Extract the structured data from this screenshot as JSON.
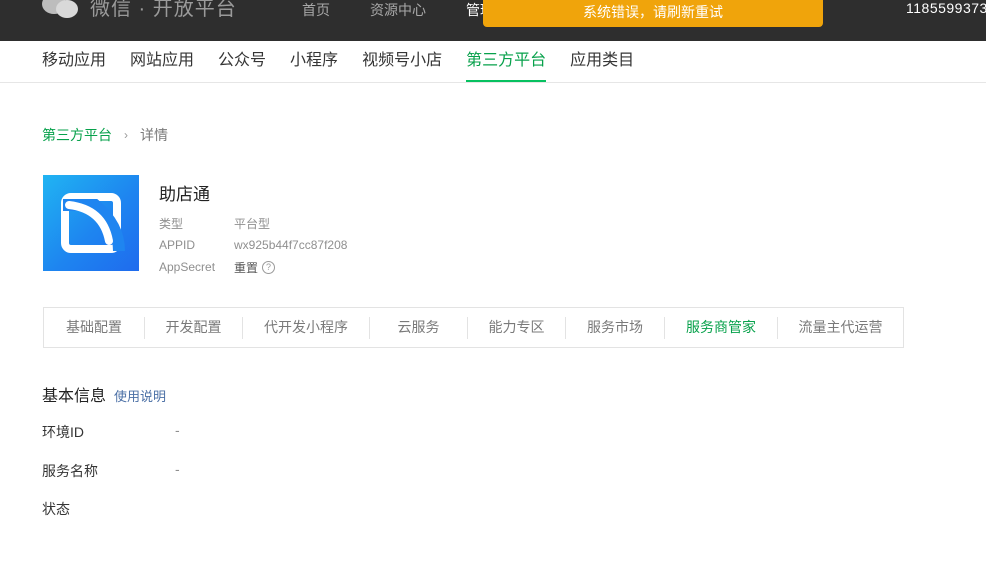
{
  "header": {
    "logo_text": "微信 · 开放平台",
    "nav": [
      "首页",
      "资源中心",
      "管理"
    ],
    "toast": "系统错误，请刷新重试",
    "user_id": "1185599373"
  },
  "subnav": {
    "items": [
      "移动应用",
      "网站应用",
      "公众号",
      "小程序",
      "视频号小店",
      "第三方平台",
      "应用类目"
    ],
    "active_index": 5
  },
  "breadcrumb": {
    "parent": "第三方平台",
    "separator": "›",
    "current": "详情"
  },
  "app": {
    "name": "助店通",
    "type_label": "类型",
    "type_value": "平台型",
    "appid_label": "APPID",
    "appid_value": "wx925b44f7cc87f208",
    "secret_label": "AppSecret",
    "secret_action": "重置",
    "help_glyph": "?"
  },
  "tabs": {
    "items": [
      "基础配置",
      "开发配置",
      "代开发小程序",
      "云服务",
      "能力专区",
      "服务市场",
      "服务商管家",
      "流量主代运营"
    ],
    "active_index": 6
  },
  "basic_info": {
    "title": "基本信息",
    "help_link": "使用说明",
    "env_label": "环境ID",
    "env_value": "-",
    "service_label": "服务名称",
    "service_value": "-",
    "status_label": "状态"
  },
  "colors": {
    "accent": "#07c160",
    "header_bg": "#2e2e2e",
    "toast_bg": "#f0a40b",
    "logo_blue": "#1f85f0"
  }
}
